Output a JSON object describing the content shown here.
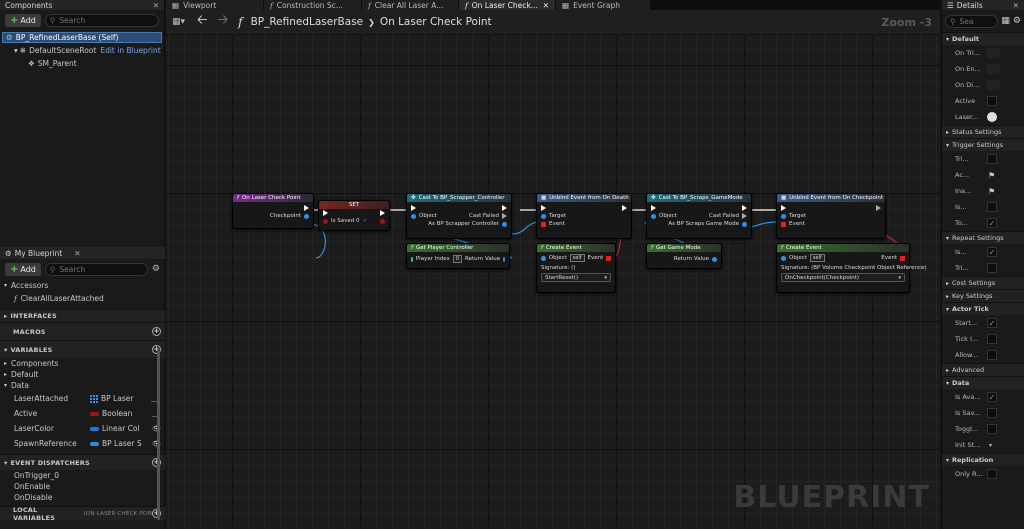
{
  "components": {
    "tab": "Components",
    "add_label": "Add",
    "search_placeholder": "Search",
    "tree": [
      {
        "label": "BP_RefinedLaserBase (Self)"
      },
      {
        "label": "DefaultSceneRoot",
        "link": "Edit in Blueprint"
      },
      {
        "label": "SM_Parent"
      }
    ]
  },
  "my_blueprint": {
    "tab": "My Blueprint",
    "add_label": "Add",
    "search_placeholder": "Search",
    "accessors": "Accessors",
    "function_item": "ClearAllLaserAttached",
    "interfaces": "INTERFACES",
    "macros": "MACROS",
    "variables": "VARIABLES",
    "var_groups": [
      "Components",
      "Default",
      "Data"
    ],
    "vars": [
      {
        "name": "LaserAttached",
        "type": "BP Laser",
        "color": "#3b8fe0",
        "grid": true
      },
      {
        "name": "Active",
        "type": "Boolean",
        "color": "#a01414",
        "grid": false
      },
      {
        "name": "LaserColor",
        "type": "Linear Col",
        "color": "#1f78d8",
        "grid": false
      },
      {
        "name": "SpawnReference",
        "type": "BP Laser S",
        "color": "#1f8fe8",
        "grid": false
      }
    ],
    "event_dispatchers": "EVENT DISPATCHERS",
    "dispatchers": [
      "OnTrigger_0",
      "OnEnable",
      "OnDisable"
    ],
    "local_variables": "LOCAL VARIABLES",
    "local_scope": "(ON LASER CHECK POIN"
  },
  "editor_tabs": [
    "Viewport",
    "Construction Sc...",
    "Clear All Laser A...",
    "On Laser Check...",
    "Event Graph"
  ],
  "breadcrumb": {
    "title": "BP_RefinedLaserBase",
    "separator": "❯",
    "current": "On Laser Check Point",
    "zoom": "Zoom -3"
  },
  "watermark": "BLUEPRINT",
  "nodes": {
    "entry": {
      "title": "On Laser Check Point",
      "pin": "Checkpoint"
    },
    "set": {
      "title": "SET",
      "pin": "Is Saved 0"
    },
    "cast1": {
      "title": "Cast To BP_Scrapper_Controller",
      "object": "Object",
      "failed": "Cast Failed",
      "as": "As BP Scrapper Controller"
    },
    "unbind1": {
      "title": "Unbind Event from On Death",
      "target": "Target",
      "event": "Event"
    },
    "cast2": {
      "title": "Cast To BP_Scraps_GameMode",
      "object": "Object",
      "failed": "Cast Failed",
      "as": "As BP Scraps Game Mode"
    },
    "unbind2": {
      "title": "Unbind Event from On Checkpoint",
      "target": "Target",
      "event": "Event"
    },
    "getpc": {
      "title": "Get Player Controller",
      "pin": "Player Index",
      "value": "0",
      "ret": "Return Value"
    },
    "create1": {
      "title": "Create Event",
      "object": "Object",
      "self": "self",
      "event": "Event",
      "signature": "Signature: ()",
      "selected": "StartReset()"
    },
    "getgm": {
      "title": "Get Game Mode",
      "ret": "Return Value"
    },
    "create2": {
      "title": "Create Event",
      "object": "Object",
      "self": "self",
      "event": "Event",
      "signature": "Signature: (BP Volume Checkpoint Object Reference)",
      "selected": "OnCheckpoint(Checkpoint)"
    }
  },
  "details": {
    "tab": "Details",
    "search_placeholder": "Sea",
    "sections": [
      {
        "title": "Default",
        "bold": true,
        "expanded": true,
        "rows": [
          {
            "label": "On Tri...",
            "kind": "empty"
          },
          {
            "label": "On En...",
            "kind": "empty"
          },
          {
            "label": "On Di...",
            "kind": "empty"
          },
          {
            "label": "Active",
            "kind": "unchecked"
          },
          {
            "label": "Laser...",
            "kind": "color"
          }
        ]
      },
      {
        "title": "Status Settings",
        "bold": false,
        "expanded": false,
        "rows": []
      },
      {
        "title": "Trigger Settings",
        "bold": false,
        "expanded": true,
        "rows": [
          {
            "label": "Tri...",
            "kind": "unchecked"
          },
          {
            "label": "Ac...",
            "kind": "flag"
          },
          {
            "label": "Ina...",
            "kind": "flag"
          },
          {
            "label": "Is...",
            "kind": "unchecked"
          },
          {
            "label": "To...",
            "kind": "checked"
          }
        ]
      },
      {
        "title": "Repeat Settings",
        "bold": false,
        "expanded": true,
        "rows": [
          {
            "label": "Is...",
            "kind": "checked"
          },
          {
            "label": "Tri...",
            "kind": "unchecked"
          }
        ]
      },
      {
        "title": "Cost Settings",
        "bold": false,
        "expanded": false,
        "rows": []
      },
      {
        "title": "Key Settings",
        "bold": false,
        "expanded": false,
        "rows": []
      },
      {
        "title": "Actor Tick",
        "bold": true,
        "expanded": true,
        "rows": [
          {
            "label": "Start...",
            "kind": "checked"
          },
          {
            "label": "Tick I...",
            "kind": "unchecked"
          },
          {
            "label": "Allow...",
            "kind": "unchecked"
          }
        ]
      },
      {
        "title": "Advanced",
        "bold": false,
        "expanded": false,
        "rows": []
      },
      {
        "title": "Data",
        "bold": true,
        "expanded": true,
        "rows": [
          {
            "label": "Is Ava...",
            "kind": "checked"
          },
          {
            "label": "Is Sav...",
            "kind": "unchecked"
          },
          {
            "label": "Toggl...",
            "kind": "unchecked"
          },
          {
            "label": "Init St...",
            "kind": "dropdown"
          }
        ]
      },
      {
        "title": "Replication",
        "bold": true,
        "expanded": true,
        "rows": [
          {
            "label": "Only R...",
            "kind": "unchecked"
          }
        ]
      }
    ]
  }
}
